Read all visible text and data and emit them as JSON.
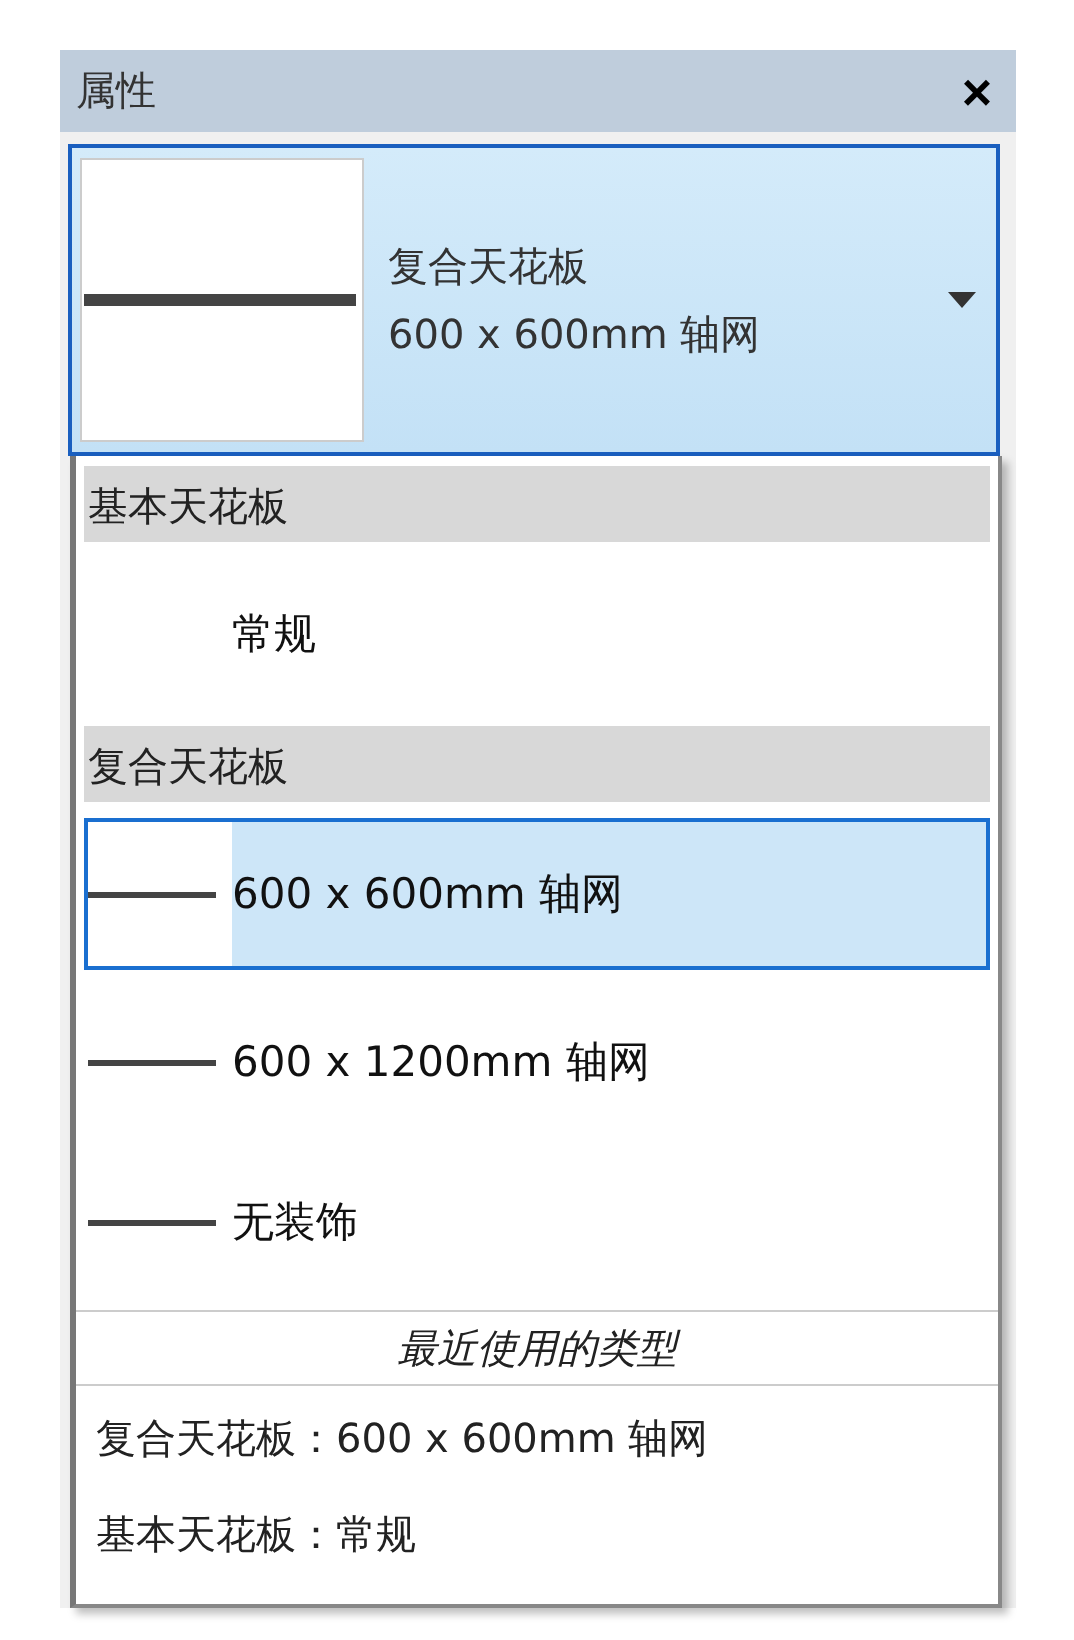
{
  "panel": {
    "title": "属性",
    "close": "×"
  },
  "type_selector": {
    "family": "复合天花板",
    "type": "600 x 600mm 轴网",
    "expanded": true
  },
  "groups": [
    {
      "heading": "基本天花板",
      "items": [
        {
          "label": "常规",
          "preview": false,
          "selected": false
        }
      ]
    },
    {
      "heading": "复合天花板",
      "items": [
        {
          "label": "600 x 600mm 轴网",
          "preview": true,
          "selected": true
        },
        {
          "label": "600 x 1200mm 轴网",
          "preview": true,
          "selected": false
        },
        {
          "label": "无装饰",
          "preview": true,
          "selected": false
        }
      ]
    }
  ],
  "recent": {
    "heading": "最近使用的类型",
    "items": [
      "复合天花板：600 x 600mm 轴网",
      "基本天花板：常规"
    ]
  }
}
